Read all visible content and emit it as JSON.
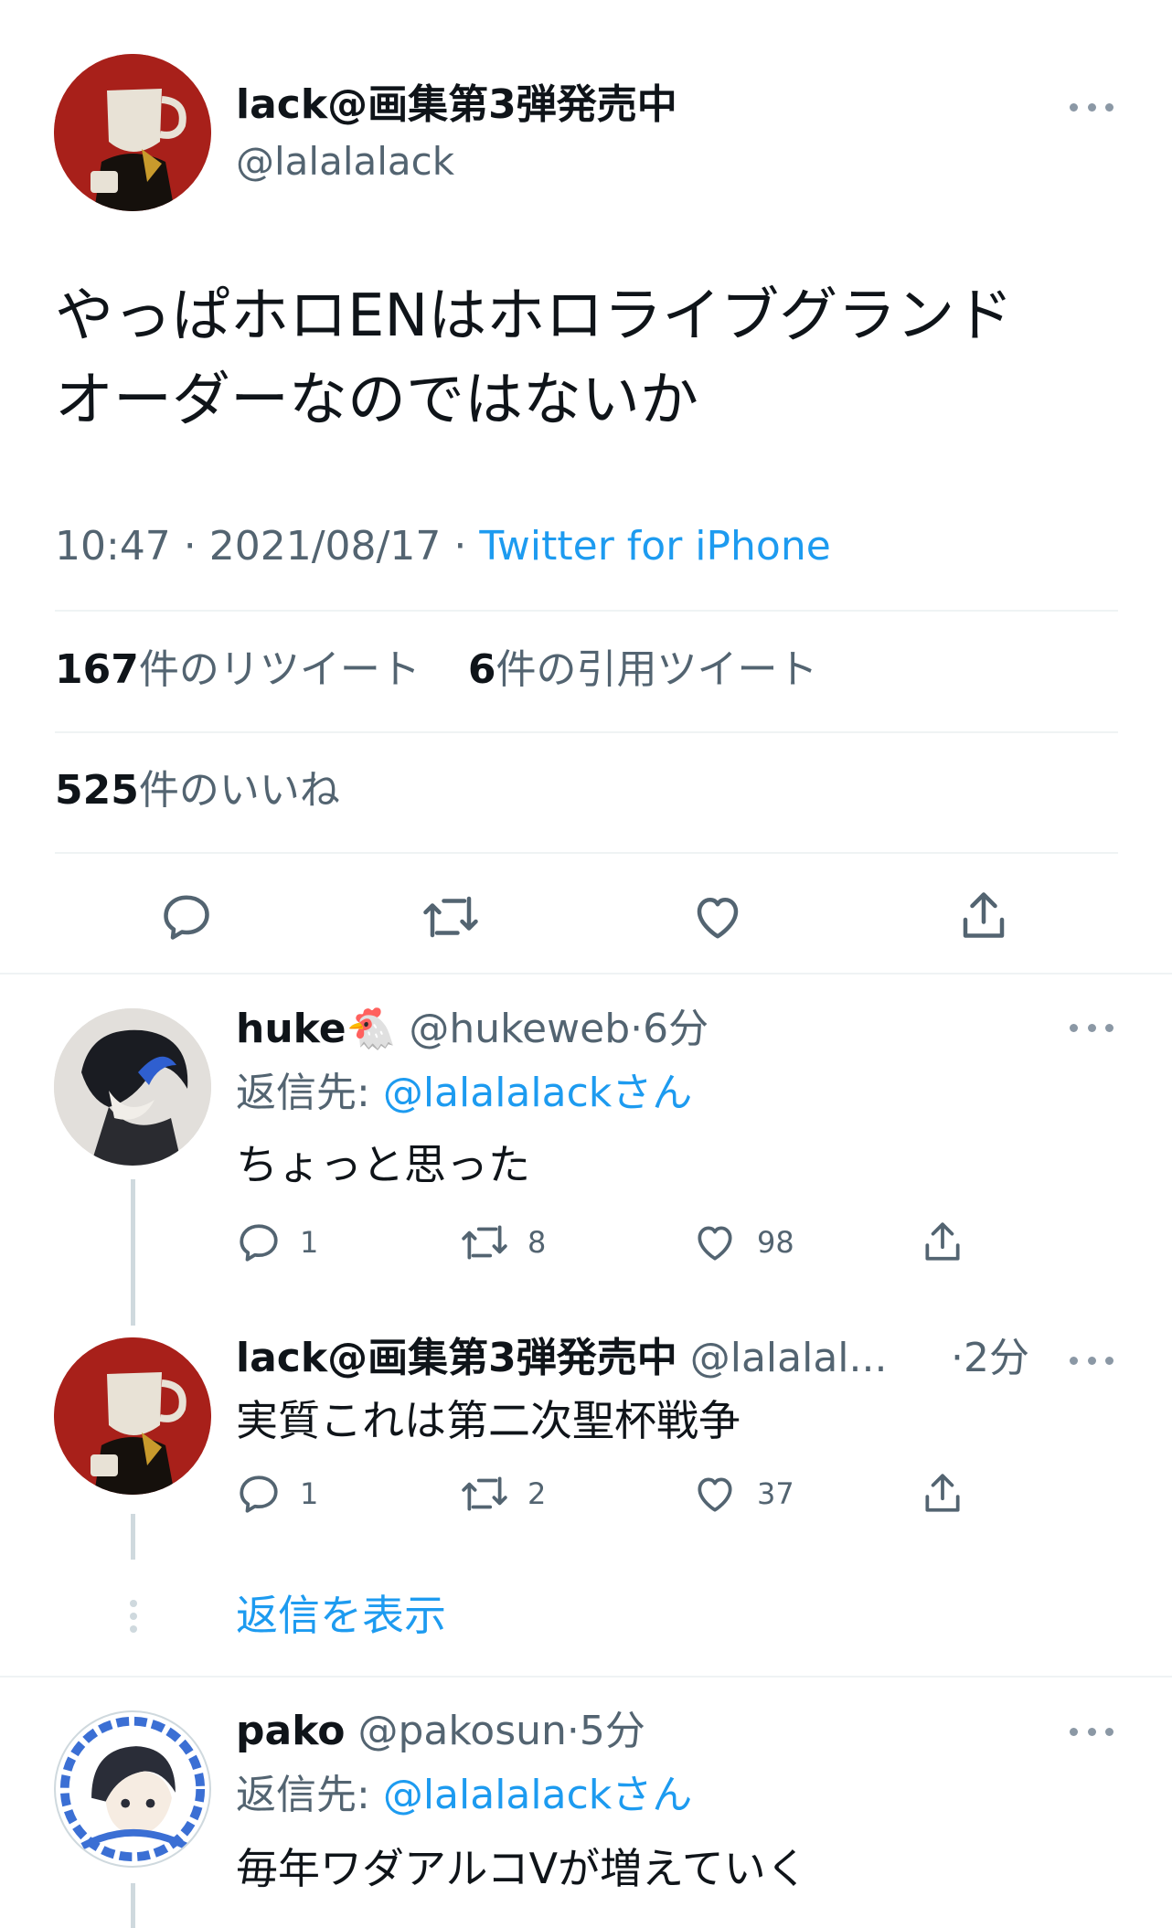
{
  "main_tweet": {
    "display_name": "lack@画集第3弾発売中",
    "handle": "@lalalalack",
    "text_line1": "やっぱホロENはホロライブグランド",
    "text_line2": "オーダーなのではないか",
    "time": "10:47 · 2021/08/17 · ",
    "source": "Twitter for iPhone",
    "retweets_count": "167",
    "retweets_label": "件のリツイート",
    "quotes_count": "6",
    "quotes_label": "件の引用ツイート",
    "likes_count": "525",
    "likes_label": "件のいいね"
  },
  "replies": [
    {
      "display_name": "huke",
      "emoji": "🐔",
      "handle": "@hukeweb",
      "time": "·6分",
      "reply_to_prefix": "返信先: ",
      "reply_to": "@lalalalackさん",
      "text": "ちょっと思った",
      "reply_count": "1",
      "retweet_count": "8",
      "like_count": "98"
    },
    {
      "display_name": "lack@画集第3弾発売中",
      "handle": "@lalalal...",
      "time": "·2分",
      "text": "実質これは第二次聖杯戦争",
      "reply_count": "1",
      "retweet_count": "2",
      "like_count": "37"
    },
    {
      "display_name": "pako",
      "handle": "@pakosun",
      "time": "·5分",
      "reply_to_prefix": "返信先: ",
      "reply_to": "@lalalalackさん",
      "text": "毎年ワダアルコVが増えていく"
    }
  ],
  "show_replies": "返信を表示",
  "icons": [
    "reply-icon",
    "retweet-icon",
    "like-icon",
    "share-icon",
    "more-icon"
  ],
  "colors": {
    "link": "#1d9bf0",
    "muted": "#536471",
    "border": "#eff3f4",
    "avatar_red": "#a8201a"
  }
}
